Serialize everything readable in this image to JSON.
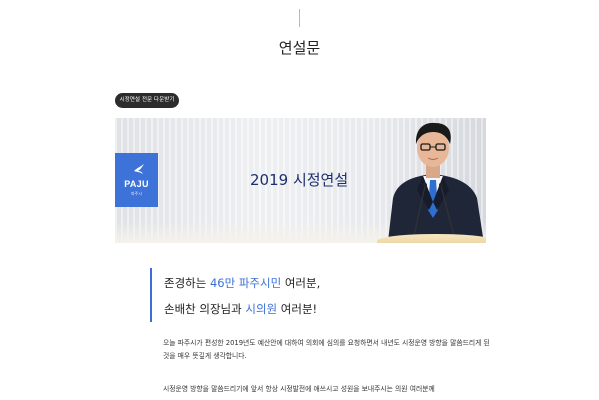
{
  "page": {
    "title": "연설문"
  },
  "download_button": {
    "label": "시정연설 전문 다운받기"
  },
  "banner": {
    "logo_text": "PAJU",
    "logo_sub": "파주시",
    "title": "2019 시정연설"
  },
  "speech": {
    "headline_line1": {
      "part1": "존경하는 ",
      "highlight1": "46만 파주시민",
      "part2": " 여러분,"
    },
    "headline_line2": {
      "part1": "손배찬 의장님과 ",
      "highlight1": "시의원",
      "part2": " 여러분!"
    },
    "paragraph1": "오늘 파주시가 편성한 2019년도 예산안에 대하여 의회에 심의를 요청하면서 내년도 시정운영 방향을 말씀드리게 된 것을 매우 뜻깊게 생각합니다.",
    "paragraph2": "시정운영 방향을 말씀드리기에 앞서 항상 시정발전에 애쓰시고 성원을 보내주시는 의원 여러분께"
  },
  "colors": {
    "accent_blue": "#3b6fd6",
    "logo_blue": "#3d72d8",
    "banner_title": "#1e2f6e",
    "button_bg": "#2c2c2c"
  }
}
